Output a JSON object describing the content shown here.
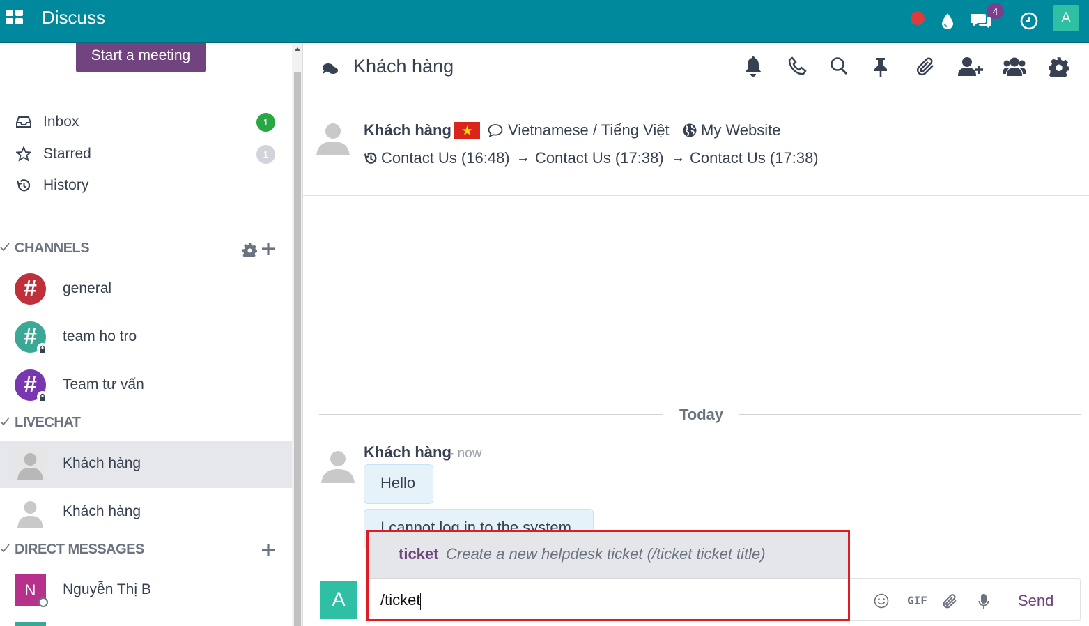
{
  "navbar": {
    "app_name": "Discuss",
    "messages_count": "4",
    "user_initial": "A",
    "colors": {
      "bar": "#00899c",
      "rec": "#e03b3b",
      "badge": "#7b3f8e"
    }
  },
  "sidebar": {
    "start_meeting": "Start a meeting",
    "mailboxes": [
      {
        "label": "Inbox",
        "count": "1",
        "icon": "inbox-icon"
      },
      {
        "label": "Starred",
        "count": "1",
        "icon": "star-icon"
      },
      {
        "label": "History",
        "count": "",
        "icon": "history-icon"
      }
    ],
    "sections": {
      "channels": "CHANNELS",
      "livechat": "LIVECHAT",
      "direct": "DIRECT MESSAGES"
    },
    "channels": [
      {
        "label": "general",
        "color": "#c0303a"
      },
      {
        "label": "team ho tro",
        "color": "#3aa894"
      },
      {
        "label": "Team tư vấn",
        "color": "#7a35b0"
      }
    ],
    "livechats": [
      {
        "label": "Khách hàng"
      },
      {
        "label": "Khách hàng"
      }
    ],
    "direct": [
      {
        "label": "Nguyễn Thị B",
        "initial": "N",
        "color": "#b6318b"
      }
    ]
  },
  "thread": {
    "title": "Khách hàng",
    "visitor": {
      "name": "Khách hàng",
      "language": "Vietnamese / Tiếng Việt",
      "website": "My Website",
      "history": [
        "Contact Us (16:48)",
        "Contact Us (17:38)",
        "Contact Us (17:38)"
      ],
      "arrow": "→"
    },
    "separator": "Today",
    "message": {
      "author": "Khách hàng",
      "time": "- now",
      "bubbles": [
        "Hello",
        "I cannot log in to the system"
      ]
    }
  },
  "suggestion": {
    "command": "ticket",
    "description": "Create a new helpdesk ticket (/ticket ticket title)"
  },
  "composer": {
    "avatar_initial": "A",
    "value": "/ticket",
    "gif_label": "GIF",
    "send_label": "Send"
  }
}
